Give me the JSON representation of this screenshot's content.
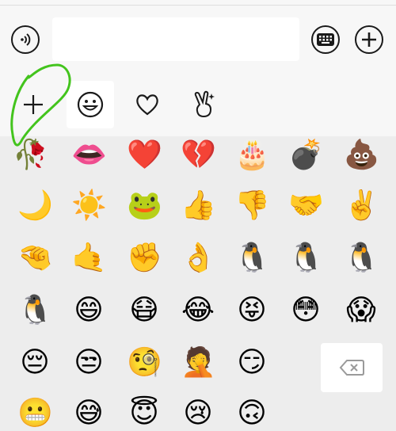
{
  "input": {
    "value": ""
  },
  "toolbar": {
    "voice_icon": "voice-icon",
    "keyboard_icon": "keyboard-icon",
    "more_icon": "plus-circle-icon"
  },
  "tabs": [
    {
      "name": "add",
      "icon": "plus-icon"
    },
    {
      "name": "smileys",
      "icon": "smiley-outline-icon",
      "selected": true
    },
    {
      "name": "favorites",
      "icon": "heart-outline-icon"
    },
    {
      "name": "gestures",
      "icon": "peace-hand-icon"
    }
  ],
  "emoji_rows": [
    [
      "🥀",
      "👄",
      "❤️",
      "💔",
      "🎂",
      "💣",
      "💩"
    ],
    [
      "🌙",
      "☀️",
      "🐸",
      "👍",
      "👎",
      "🤝",
      "✌️"
    ],
    [
      "🤏",
      "🤙",
      "✊",
      "👌",
      "🐧",
      "🐧",
      "🐧"
    ],
    [
      "🐧",
      "😄",
      "😷",
      "😂",
      "😝",
      "😳",
      "😱"
    ],
    [
      "😔",
      "😒",
      "🧐",
      "🤦",
      "😏"
    ],
    [
      "😬",
      "😅",
      "😇",
      "😢",
      "🙃"
    ]
  ],
  "delete_icon": "backspace-icon",
  "annotation_color": "#43c41d",
  "accent": "#1a1a1a"
}
